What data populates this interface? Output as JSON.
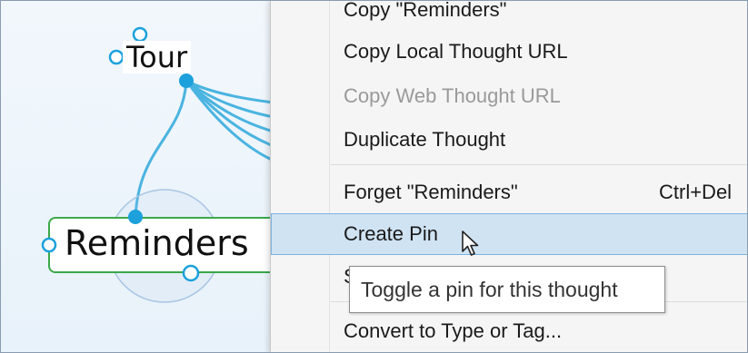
{
  "mindmap": {
    "parent_thought": "Tour",
    "active_thought": "Reminders"
  },
  "context_menu": {
    "items": [
      {
        "label": "Copy \"Reminders\"",
        "shortcut": "",
        "state": "partial"
      },
      {
        "label": "Copy Local Thought URL",
        "shortcut": "",
        "state": "enabled"
      },
      {
        "label": "Copy Web Thought URL",
        "shortcut": "",
        "state": "disabled"
      },
      {
        "label": "Duplicate Thought",
        "shortcut": "",
        "state": "enabled"
      },
      {
        "label": "Forget \"Reminders\"",
        "shortcut": "Ctrl+Del",
        "state": "enabled"
      },
      {
        "label": "Create Pin",
        "shortcut": "",
        "state": "highlighted"
      },
      {
        "label": "S",
        "shortcut": "",
        "state": "partial"
      },
      {
        "label": "Convert to Type or Tag...",
        "shortcut": "",
        "state": "enabled"
      }
    ]
  },
  "tooltip": {
    "text": "Toggle a pin for this thought"
  },
  "colors": {
    "link": "#4ab4e0",
    "node_dot": "#1ca1dc",
    "active_border": "#3aa84a",
    "highlight": "#cfe3f3",
    "disabled_text": "#9a9a9a"
  }
}
